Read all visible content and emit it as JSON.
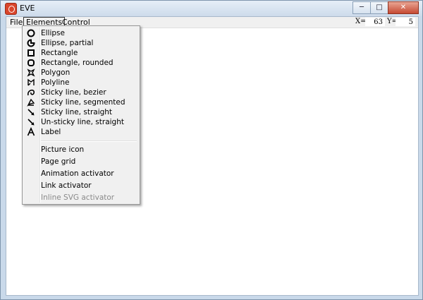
{
  "window": {
    "title": "EVE"
  },
  "caption": {
    "minimize": "─",
    "maximize": "□",
    "close": "✕"
  },
  "menubar": {
    "items": [
      {
        "label": "File"
      },
      {
        "label": "Elements"
      },
      {
        "label": "Control"
      }
    ],
    "x_label": "X=",
    "x_value": "63",
    "y_label": "Y=",
    "y_value": "5"
  },
  "elements_menu": {
    "shape_items": [
      {
        "label": "Ellipse",
        "icon": "ellipse-icon"
      },
      {
        "label": "Ellipse, partial",
        "icon": "ellipse-partial-icon"
      },
      {
        "label": "Rectangle",
        "icon": "rectangle-icon"
      },
      {
        "label": "Rectangle, rounded",
        "icon": "rounded-rectangle-icon"
      },
      {
        "label": "Polygon",
        "icon": "polygon-icon"
      },
      {
        "label": "Polyline",
        "icon": "polyline-icon"
      },
      {
        "label": "Sticky line, bezier",
        "icon": "bezier-line-icon"
      },
      {
        "label": "Sticky line, segmented",
        "icon": "segmented-line-icon"
      },
      {
        "label": "Sticky line, straight",
        "icon": "straight-line-icon"
      },
      {
        "label": "Un-sticky line, straight",
        "icon": "unsticky-line-icon"
      },
      {
        "label": "Label",
        "icon": "label-icon"
      }
    ],
    "other_items": [
      {
        "label": "Picture icon",
        "enabled": true
      },
      {
        "label": "Page grid",
        "enabled": true
      },
      {
        "label": "Animation activator",
        "enabled": true
      },
      {
        "label": "Link activator",
        "enabled": true
      },
      {
        "label": "Inline SVG activator",
        "enabled": false
      }
    ]
  }
}
